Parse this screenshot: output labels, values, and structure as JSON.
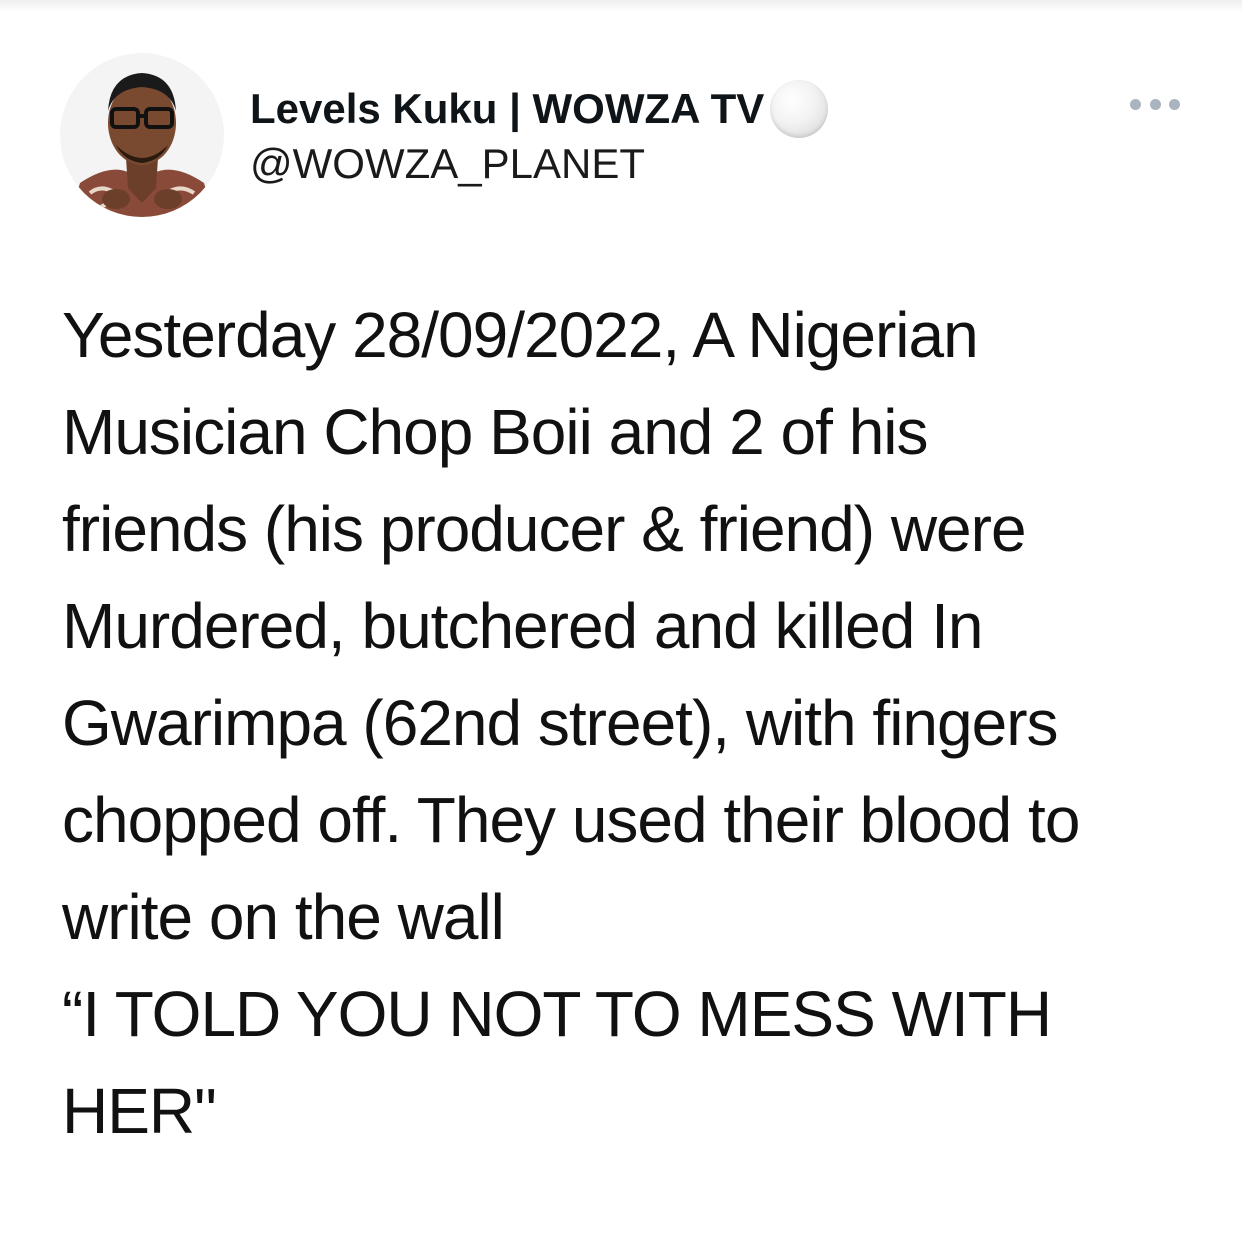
{
  "tweet": {
    "author": {
      "display_name": "Levels Kuku | WOWZA TV",
      "handle": "@WOWZA_PLANET",
      "avatar_icon": "profile-photo",
      "verified_icon": "grey-circle-badge"
    },
    "more_icon": "ellipsis-icon",
    "body_lines": [
      "Yesterday 28/09/2022, A Nigerian",
      "Musician Chop Boii and 2 of his",
      "friends (his producer & friend) were",
      "Murdered, butchered and killed In",
      "Gwarimpa (62nd street), with fingers",
      "chopped off. They used their blood to",
      "write on the wall"
    ],
    "quote_lines": [
      "“I TOLD YOU NOT TO MESS WITH",
      "HER\""
    ]
  },
  "colors": {
    "text": "#111111",
    "background": "#ffffff",
    "icon_grey": "#aab4be"
  }
}
